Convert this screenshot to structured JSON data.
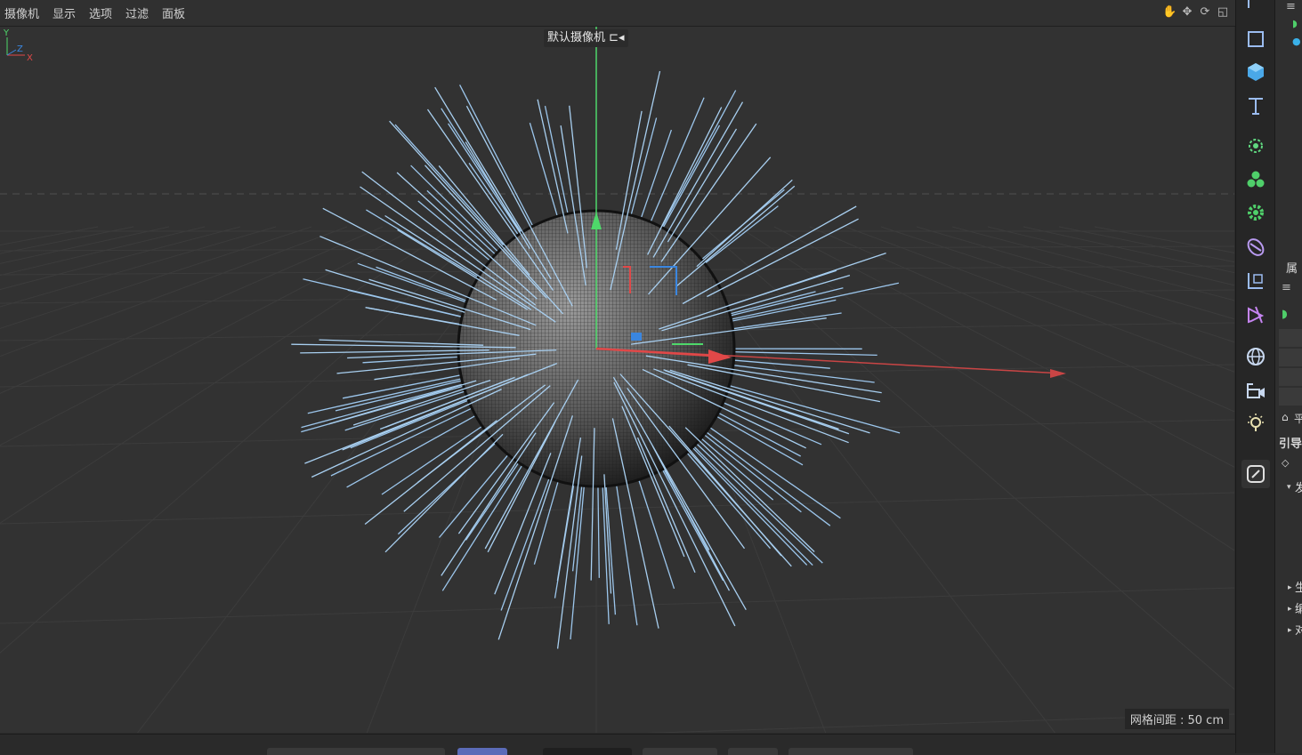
{
  "menu": {
    "items": [
      {
        "label": "摄像机"
      },
      {
        "label": "显示"
      },
      {
        "label": "选项"
      },
      {
        "label": "过滤"
      },
      {
        "label": "面板"
      }
    ]
  },
  "nav_icons": [
    "hand-pan-icon",
    "move-camera-icon",
    "rotate-camera-icon",
    "maximize-view-icon"
  ],
  "viewport": {
    "camera_label": "默认摄像机",
    "grid_spacing": "网格间距 : 50 cm",
    "axis": {
      "y": "Y",
      "z": "Z",
      "x": "X"
    }
  },
  "colors": {
    "viewport_bg": "#323232",
    "normals": "#9cc6ec",
    "axis_x": "#e04848",
    "axis_y": "#4ed86a",
    "axis_z": "#3a86e0"
  },
  "toolbar": {
    "tools": [
      "select-tool-icon",
      "rectangle-icon",
      "cube-icon",
      "text-icon",
      "bone-deformer-icon",
      "mograph-cloner-icon",
      "effector-gear-icon",
      "deformer-icon",
      "scene-hierarchy-icon",
      "spline-pen-icon",
      "globe-environment-icon",
      "camera-icon",
      "light-bulb-icon",
      "tag-edit-icon"
    ]
  },
  "side_panel": {
    "attributes_label": "属",
    "guide_label": "引导",
    "rows": [
      "生",
      "编",
      "对"
    ],
    "section_label": "发",
    "misc_label": "平"
  }
}
